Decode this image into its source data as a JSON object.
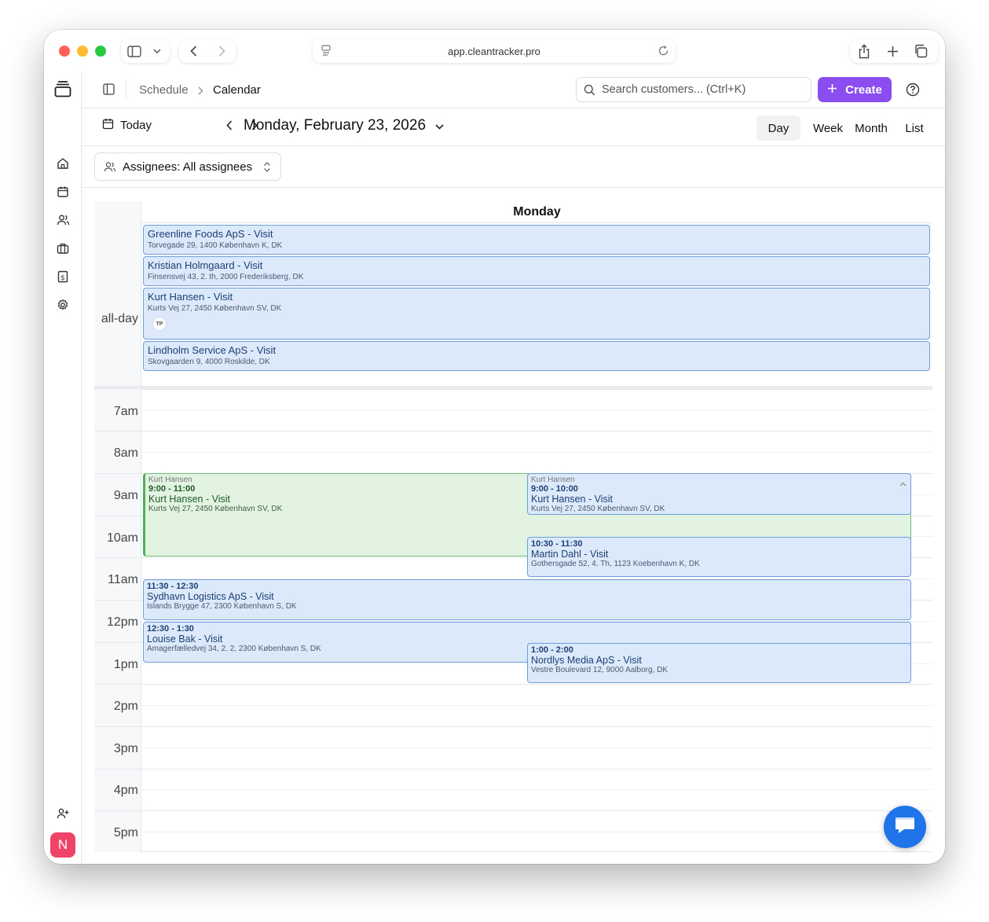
{
  "browser": {
    "url": "app.cleantracker.pro"
  },
  "header": {
    "breadcrumb": [
      "Schedule",
      "Calendar"
    ],
    "search_placeholder": "Search customers... (Ctrl+K)",
    "create_label": "Create"
  },
  "toolbar": {
    "today_label": "Today",
    "date_title": "Monday, February 23, 2026",
    "views": [
      "Day",
      "Week",
      "Month",
      "List"
    ],
    "active_view": "Day"
  },
  "filter": {
    "assignees_label": "Assignees: All assignees"
  },
  "calendar": {
    "day_header": "Monday",
    "allday_label": "all-day",
    "hours": [
      "7am",
      "8am",
      "9am",
      "10am",
      "11am",
      "12pm",
      "1pm",
      "2pm",
      "3pm",
      "4pm",
      "5pm"
    ],
    "allday_events": [
      {
        "title": "Greenline Foods ApS - Visit",
        "address": "Torvegade 29, 1400 København K, DK"
      },
      {
        "title": "Kristian Holmgaard - Visit",
        "address": "Finsensvej 43, 2. th, 2000 Frederiksberg, DK"
      },
      {
        "title": "Kurt Hansen - Visit",
        "address": "Kurts Vej 27, 2450 København SV, DK",
        "badge": "TP"
      },
      {
        "title": "Lindholm Service ApS - Visit",
        "address": "Skovgaarden 9, 4000 Roskilde, DK"
      }
    ],
    "timed_events": [
      {
        "assignee": "Kurt Hansen",
        "time": "9:00 - 11:00",
        "title": "Kurt Hansen - Visit",
        "address": "Kurts Vej 27, 2450 København SV, DK",
        "color": "green"
      },
      {
        "assignee": "Kurt Hansen",
        "time": "9:00 - 10:00",
        "title": "Kurt Hansen - Visit",
        "address": "Kurts Vej 27, 2450 København SV, DK",
        "color": "blue"
      },
      {
        "time": "10:30 - 11:30",
        "title": "Martin Dahl - Visit",
        "address": "Gothersgade 52, 4. Th, 1123 Koebenhavn K, DK",
        "color": "blue"
      },
      {
        "time": "11:30 - 12:30",
        "title": "Sydhavn Logistics ApS - Visit",
        "address": "Islands Brygge 47, 2300 København S, DK",
        "color": "blue"
      },
      {
        "time": "12:30 - 1:30",
        "title": "Louise Bak - Visit",
        "address": "Amagerfælledvej 34, 2. 2, 2300 København S, DK",
        "color": "blue"
      },
      {
        "time": "1:00 - 2:00",
        "title": "Nordlys Media ApS - Visit",
        "address": "Vestre Boulevard 12, 9000 Aalborg, DK",
        "color": "blue"
      }
    ]
  },
  "sidebar": {
    "items": [
      "home-icon",
      "calendar-icon",
      "users-icon",
      "briefcase-icon",
      "invoice-icon",
      "settings-icon"
    ],
    "avatar_initial": "N"
  },
  "colors": {
    "accent": "#8b4cf0",
    "event_blue": "#dbe9fb",
    "event_green": "#e2f3e2",
    "avatar": "#ef4368",
    "chat": "#1e74e8"
  }
}
